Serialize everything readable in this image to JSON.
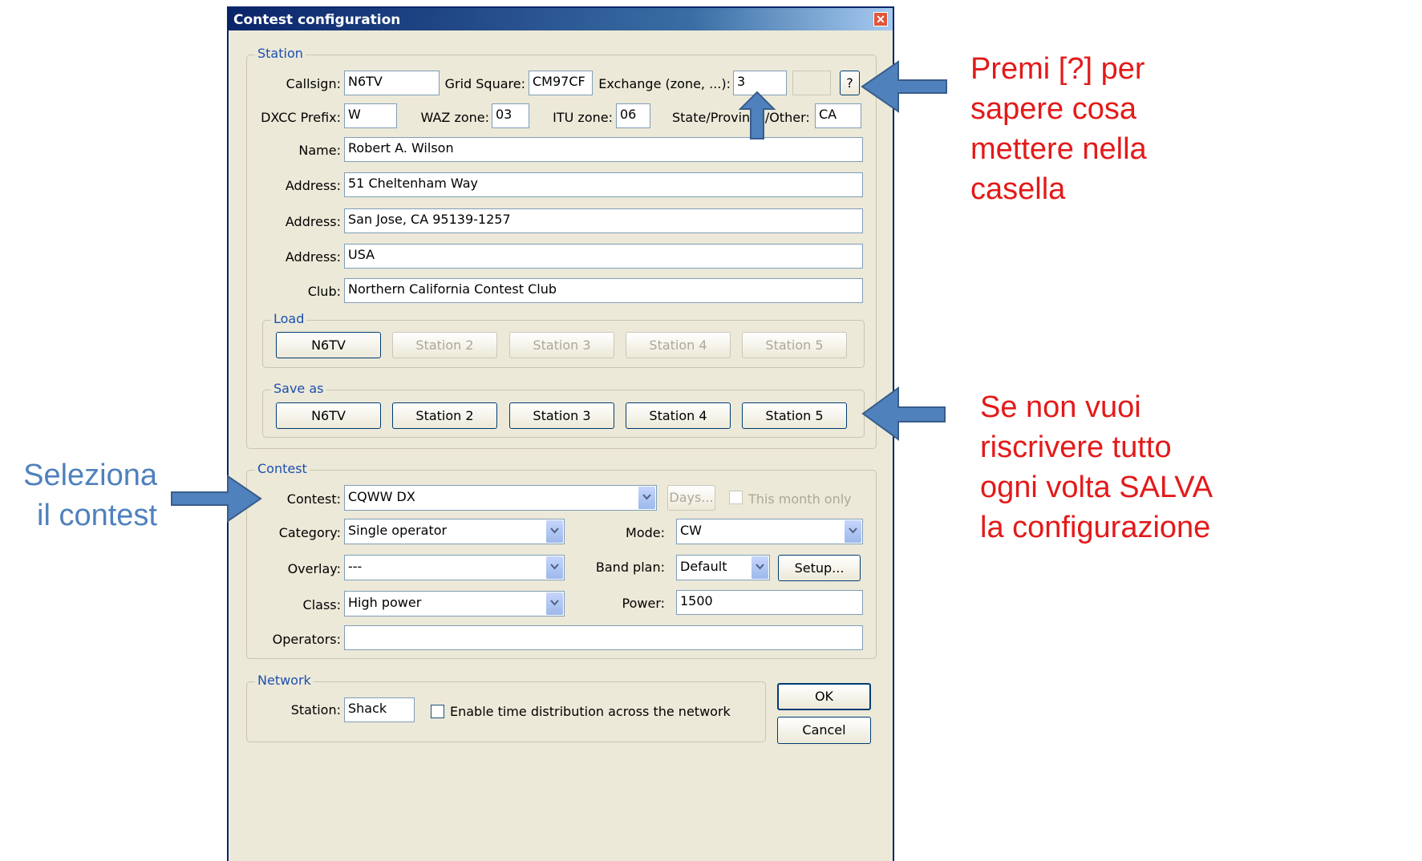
{
  "window": {
    "title": "Contest configuration"
  },
  "station": {
    "group_label": "Station",
    "callsign_label": "Callsign:",
    "callsign": "N6TV",
    "grid_label": "Grid Square:",
    "grid": "CM97CF",
    "exchange_label": "Exchange (zone, ...):",
    "exchange": "3",
    "help_label": "?",
    "dxcc_label": "DXCC Prefix:",
    "dxcc": "W",
    "waz_label": "WAZ zone:",
    "waz": "03",
    "itu_label": "ITU zone:",
    "itu": "06",
    "state_label": "State/Province/Other:",
    "state": "CA",
    "name_label": "Name:",
    "name": "Robert A. Wilson",
    "address_label": "Address:",
    "address1": "51 Cheltenham Way",
    "address2": "San Jose, CA  95139-1257",
    "address3": "USA",
    "club_label": "Club:",
    "club": "Northern California Contest Club",
    "load": {
      "label": "Load",
      "buttons": [
        "N6TV",
        "Station 2",
        "Station 3",
        "Station 4",
        "Station 5"
      ]
    },
    "save": {
      "label": "Save as",
      "buttons": [
        "N6TV",
        "Station 2",
        "Station 3",
        "Station 4",
        "Station 5"
      ]
    }
  },
  "contest": {
    "group_label": "Contest",
    "contest_label": "Contest:",
    "contest": "CQWW DX",
    "days_label": "Days...",
    "month_only_label": "This month only",
    "category_label": "Category:",
    "category": "Single operator",
    "mode_label": "Mode:",
    "mode": "CW",
    "overlay_label": "Overlay:",
    "overlay": "---",
    "bandplan_label": "Band plan:",
    "bandplan": "Default",
    "setup_label": "Setup...",
    "class_label": "Class:",
    "class": "High power",
    "power_label": "Power:",
    "power": "1500",
    "operators_label": "Operators:",
    "operators": ""
  },
  "network": {
    "group_label": "Network",
    "station_label": "Station:",
    "station": "Shack",
    "time_dist_label": "Enable time distribution across the network"
  },
  "buttons": {
    "ok": "OK",
    "cancel": "Cancel"
  },
  "annotations": {
    "help_note": [
      "Premi [?] per",
      "sapere cosa",
      "mettere nella",
      "casella"
    ],
    "save_note": [
      "Se non vuoi",
      "riscrivere tutto",
      "ogni volta SALVA",
      "la configurazione"
    ],
    "contest_note": [
      "Seleziona",
      "il contest"
    ]
  },
  "colors": {
    "arrow": "#4f81bd",
    "annotation_red": "#e31a1a",
    "annotation_blue": "#4f81bd"
  }
}
